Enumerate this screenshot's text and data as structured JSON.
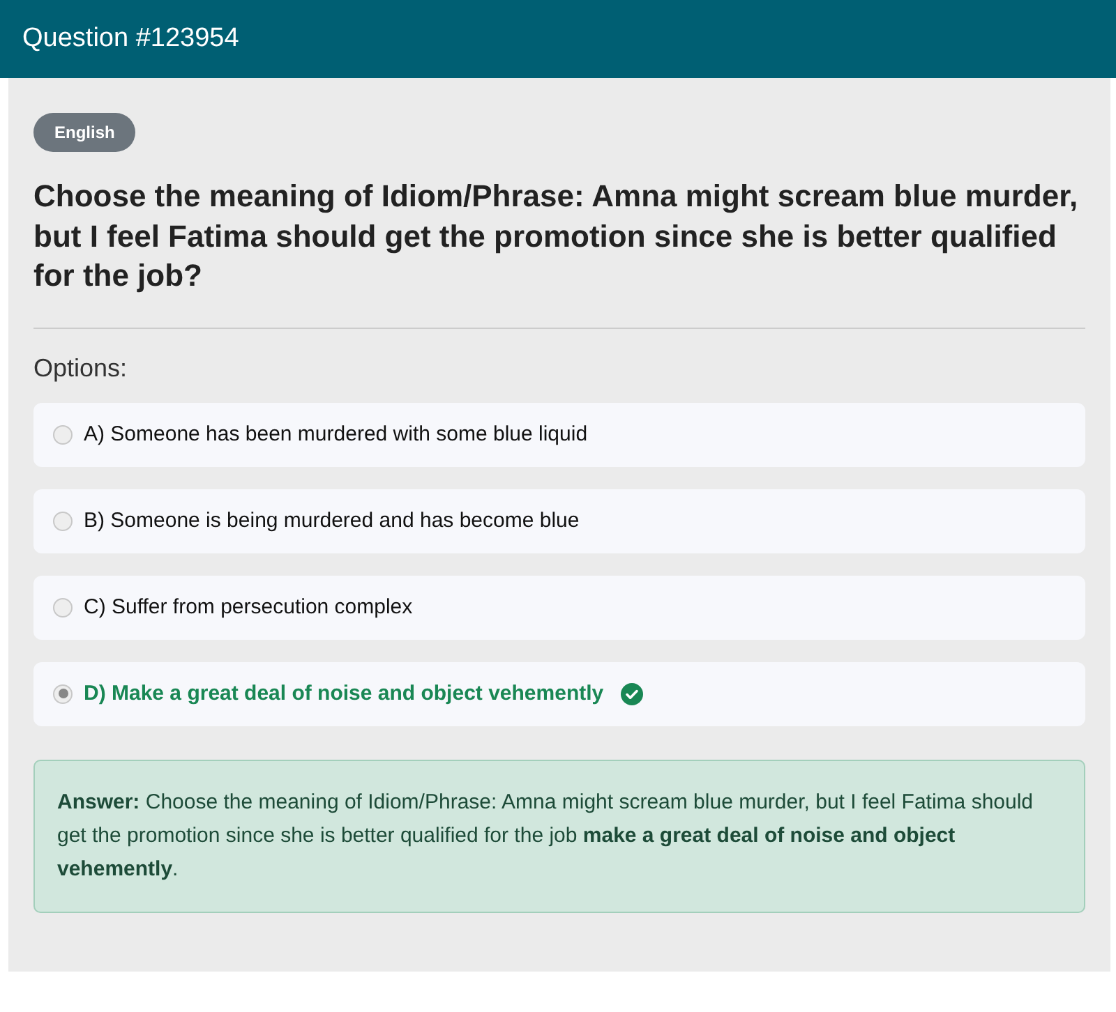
{
  "header": {
    "title": "Question #123954"
  },
  "badge": "English",
  "question": "Choose the meaning of Idiom/Phrase: Amna might scream blue murder, but I feel Fatima should get the promotion since she is better qualified for the job?",
  "options_label": "Options:",
  "options": [
    {
      "text": "A) Someone has been murdered with some blue liquid",
      "selected": false,
      "correct": false
    },
    {
      "text": "B) Someone is being murdered and has become blue",
      "selected": false,
      "correct": false
    },
    {
      "text": "C) Suffer from persecution complex",
      "selected": false,
      "correct": false
    },
    {
      "text": "D) Make a great deal of noise and object vehemently",
      "selected": true,
      "correct": true
    }
  ],
  "answer": "**Answer:** Choose the meaning of Idiom/Phrase: Amna might scream blue murder, but I feel Fatima should get the promotion since she is better qualified for the job **make a great deal of noise and object vehemently**."
}
